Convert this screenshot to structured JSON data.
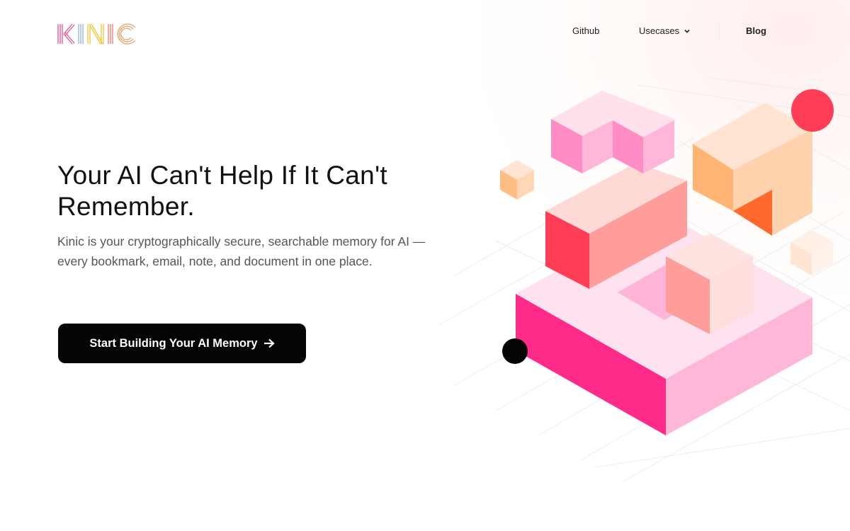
{
  "brand": {
    "name": "KINIC",
    "letters": [
      "K",
      "I",
      "N",
      "I",
      "C"
    ],
    "colors": [
      "#e74f8d",
      "#8ab4e8",
      "#f2c230",
      "#f07a6e",
      "#e2a36a"
    ]
  },
  "nav": {
    "github": "Github",
    "usecases": "Usecases",
    "blog": "Blog"
  },
  "hero": {
    "title_line1": "Your AI Can't Help If It Can't",
    "title_line2": "Remember.",
    "subtitle": "Kinic is your cryptographically secure, searchable memory for AI — every bookmark, email, note, and document in one place.",
    "cta_label": "Start Building Your AI Memory"
  },
  "icons": {
    "nav_usecases": "chevron-down-icon",
    "cta": "arrow-right-icon"
  },
  "accents": {
    "cta_bg": "#050505",
    "pink": "#ff2b8a",
    "red_dot": "#ff3d57",
    "peach": "#ffbf86"
  }
}
